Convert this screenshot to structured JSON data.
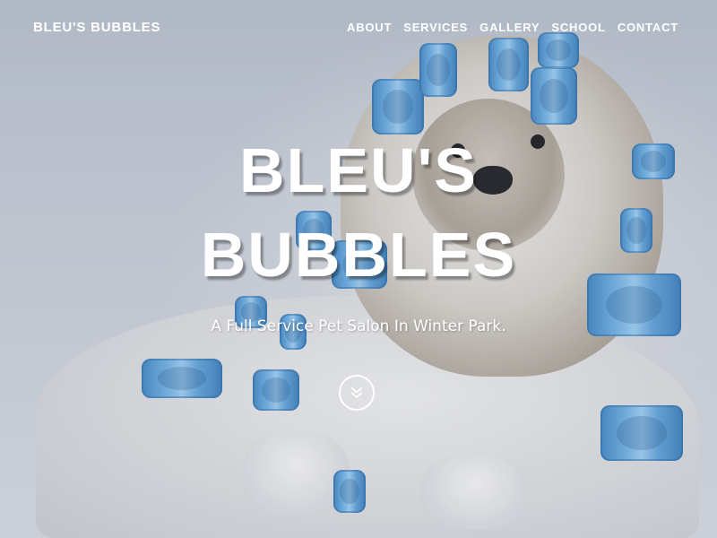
{
  "brand": {
    "name": "BLEU'S BUBBLES"
  },
  "nav": {
    "items": [
      {
        "label": "ABOUT"
      },
      {
        "label": "SERVICES"
      },
      {
        "label": "GALLERY"
      },
      {
        "label": "SCHOOL"
      },
      {
        "label": "CONTACT"
      }
    ]
  },
  "hero": {
    "title_line1": "BLEU'S",
    "title_line2": "BUBBLES",
    "subtitle": "A Full Service Pet Salon In Winter Park.",
    "scroll_icon": "chevron-double-down-icon",
    "image": "shih-tzu-with-blue-hair-curlers"
  },
  "colors": {
    "text": "#ffffff",
    "curler_blue": "#5fa3da",
    "background": "#c6ccd6"
  }
}
